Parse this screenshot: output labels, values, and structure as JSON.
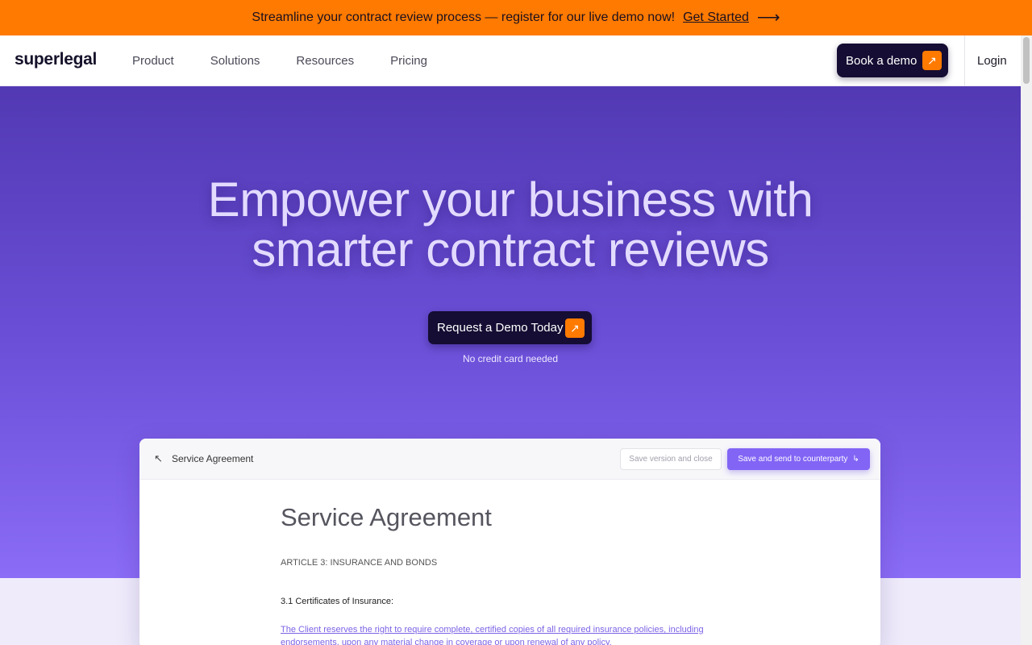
{
  "announcement": {
    "text": "Streamline your contract review process — register for our live demo now!",
    "link_label": "Get Started",
    "arrow": "⟶"
  },
  "nav": {
    "logo": "superlegal",
    "links": [
      "Product",
      "Solutions",
      "Resources",
      "Pricing"
    ],
    "book_demo_label": "Book a demo",
    "login_label": "Login"
  },
  "hero": {
    "headline_line1": "Empower your business with",
    "headline_line2": "smarter contract reviews",
    "cta_label": "Request a Demo Today",
    "cta_note": "No credit card needed"
  },
  "document": {
    "toolbar_title": "Service Agreement",
    "save_close_label": "Save version and close",
    "save_send_label": "Save and send to counterparty",
    "title": "Service Agreement",
    "article": "ARTICLE 3: INSURANCE AND BONDS",
    "section": "3.1 Certificates of Insurance:",
    "clause": "The Client reserves the right to require complete, certified copies of all required insurance policies, including endorsements, upon any material change in coverage or upon renewal of any policy."
  },
  "icons": {
    "external_arrow": "↗",
    "back_arrow": "↖",
    "send_arrow": "↳"
  },
  "colors": {
    "announcement_bg": "#ff7a00",
    "brand_dark": "#150d33",
    "hero_top": "#5239b3",
    "hero_bottom": "#8a6cf6",
    "accent_purple": "#8265f5"
  }
}
